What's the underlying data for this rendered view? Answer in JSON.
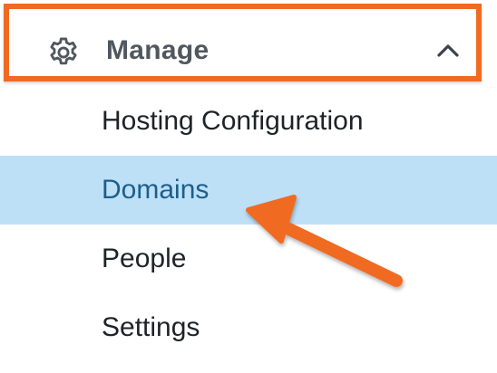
{
  "manage_section": {
    "title": "Manage",
    "gear_icon": "gear-icon",
    "collapse_icon": "chevron-up-icon",
    "highlight_color": "#f06a22"
  },
  "menu": {
    "items": [
      {
        "label": "Hosting Configuration",
        "selected": false
      },
      {
        "label": "Domains",
        "selected": true
      },
      {
        "label": "People",
        "selected": false
      },
      {
        "label": "Settings",
        "selected": false
      }
    ],
    "selected_bg": "#bde0f7",
    "selected_text": "#1e5e8a"
  },
  "annotation": {
    "arrow_icon": "pointer-arrow-icon",
    "arrow_color": "#f06a22"
  }
}
